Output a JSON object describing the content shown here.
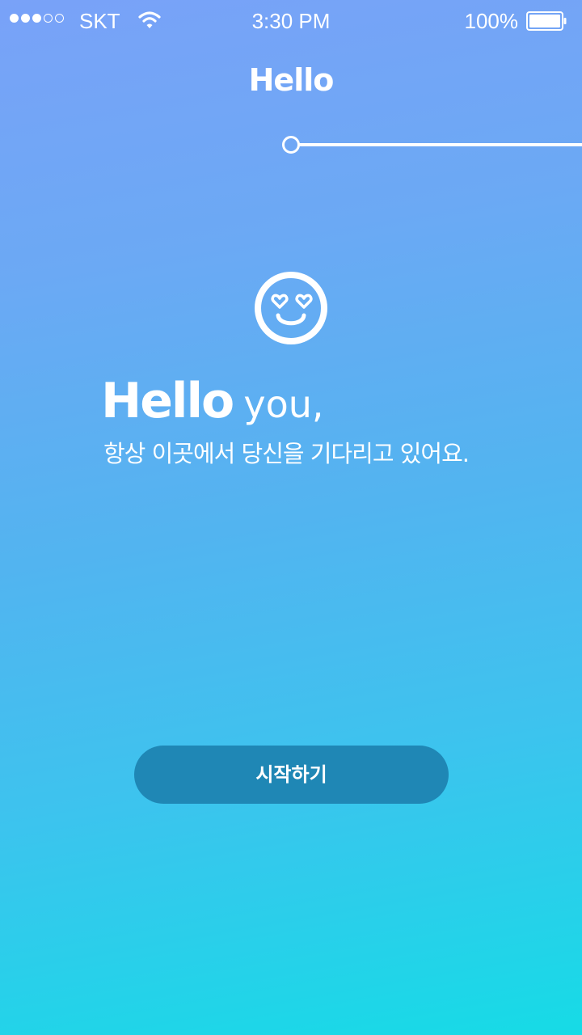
{
  "status_bar": {
    "signal_bars": 5,
    "signal_filled": 3,
    "carrier": "SKT",
    "time": "3:30 PM",
    "battery_percent": "100%",
    "battery_level": 1.0
  },
  "header": {
    "title": "Hello"
  },
  "onboarding": {
    "progress": 0.0
  },
  "hero": {
    "icon": "heart-eyes-smiley-icon",
    "greeting_big": "Hello",
    "greeting_small": "you,",
    "subtitle": "항상 이곳에서 당신을 기다리고 있어요."
  },
  "actions": {
    "start_label": "시작하기"
  },
  "colors": {
    "gradient_top": "#79a2f8",
    "gradient_bottom": "#16dbe6",
    "button_bg": "#1f87b5",
    "text": "#ffffff"
  }
}
